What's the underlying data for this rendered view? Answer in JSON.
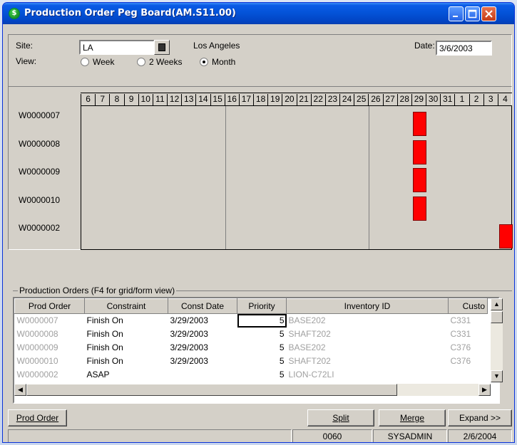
{
  "window": {
    "title": "Production Order Peg Board(AM.S11.00)",
    "icon": "app-logo-icon"
  },
  "filters": {
    "site_label": "Site:",
    "site_value": "LA",
    "site_name": "Los Angeles",
    "date_label": "Date:",
    "date_value": "3/6/2003",
    "view_label": "View:",
    "view_options": [
      "Week",
      "2 Weeks",
      "Month"
    ],
    "view_selected": "Month"
  },
  "timeline": {
    "days": [
      "6",
      "7",
      "8",
      "9",
      "10",
      "11",
      "12",
      "13",
      "14",
      "15",
      "16",
      "17",
      "18",
      "19",
      "20",
      "21",
      "22",
      "23",
      "24",
      "25",
      "26",
      "27",
      "28",
      "29",
      "30",
      "31",
      "1",
      "2",
      "3",
      "4"
    ],
    "rows": [
      "W0000007",
      "W0000008",
      "W0000009",
      "W0000010",
      "W0000002"
    ],
    "bar_color": "#ff0000",
    "bars": [
      {
        "row": "W0000007",
        "day": "29"
      },
      {
        "row": "W0000008",
        "day": "29"
      },
      {
        "row": "W0000009",
        "day": "29"
      },
      {
        "row": "W0000010",
        "day": "29"
      },
      {
        "row": "W0000002",
        "day": "4"
      }
    ]
  },
  "orders": {
    "group_label": "Production Orders (F4 for grid/form view)",
    "columns": [
      "Prod Order",
      "Constraint",
      "Const Date",
      "Priority",
      "Inventory ID",
      "Custo"
    ],
    "rows": [
      [
        "W0000007",
        "Finish On",
        "3/29/2003",
        "5",
        "BASE202",
        "C331"
      ],
      [
        "W0000008",
        "Finish On",
        "3/29/2003",
        "5",
        "SHAFT202",
        "C331"
      ],
      [
        "W0000009",
        "Finish On",
        "3/29/2003",
        "5",
        "BASE202",
        "C376"
      ],
      [
        "W0000010",
        "Finish On",
        "3/29/2003",
        "5",
        "SHAFT202",
        "C376"
      ],
      [
        "W0000002",
        "ASAP",
        "",
        "5",
        "LION-C72LI",
        ""
      ]
    ]
  },
  "buttons": {
    "prod_order": "Prod Order",
    "split": "Split",
    "merge": "Merge",
    "expand": "Expand >>"
  },
  "status_bar": {
    "code": "0060",
    "user": "SYSADMIN",
    "date": "2/6/2004"
  }
}
